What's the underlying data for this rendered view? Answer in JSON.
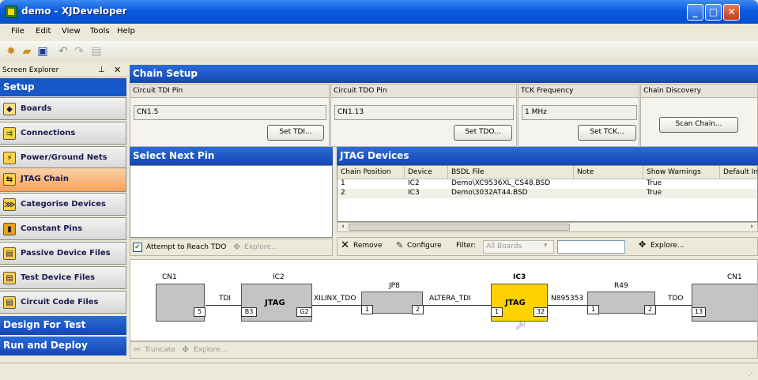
{
  "window": {
    "title": "demo - XJDeveloper",
    "min": "_",
    "max": "□",
    "close": "✕"
  },
  "menu": {
    "file": "File",
    "edit": "Edit",
    "view": "View",
    "tools": "Tools",
    "help": "Help"
  },
  "left_pane": {
    "header": "Screen Explorer",
    "setup": "Setup",
    "items": [
      {
        "label": "Boards",
        "icon": "boards-icon"
      },
      {
        "label": "Connections",
        "icon": "connections-icon"
      },
      {
        "label": "Power/Ground Nets",
        "icon": "power-icon"
      },
      {
        "label": "JTAG Chain",
        "icon": "jtag-chain-icon"
      },
      {
        "label": "Categorise Devices",
        "icon": "categorise-icon"
      },
      {
        "label": "Constant Pins",
        "icon": "lock-icon"
      },
      {
        "label": "Passive Device Files",
        "icon": "file-icon"
      },
      {
        "label": "Test Device Files",
        "icon": "file-icon"
      },
      {
        "label": "Circuit Code Files",
        "icon": "file-icon"
      }
    ],
    "design_for_test": "Design For Test",
    "run_and_deploy": "Run and Deploy"
  },
  "chain_setup": {
    "title": "Chain Setup",
    "tdi": {
      "label": "Circuit TDI Pin",
      "value": "CN1.5",
      "button": "Set TDI..."
    },
    "tdo": {
      "label": "Circuit TDO Pin",
      "value": "CN1.13",
      "button": "Set TDO..."
    },
    "tck": {
      "label": "TCK Frequency",
      "value": "1 MHz",
      "button": "Set TCK..."
    },
    "discovery": {
      "label": "Chain Discovery",
      "button": "Scan Chain..."
    }
  },
  "select_pin": {
    "title": "Select Next Pin",
    "attempt": "Attempt to Reach TDO",
    "explore": "Explore..."
  },
  "jtag_devices": {
    "title": "JTAG Devices",
    "columns": [
      "Chain Position",
      "Device",
      "BSDL File",
      "Note",
      "Show Warnings",
      "Default In"
    ],
    "rows": [
      {
        "pos": "1",
        "device": "IC2",
        "bsdl": "Demo\\XC9536XL_CS48.BSD",
        "note": "",
        "warn": "True"
      },
      {
        "pos": "2",
        "device": "IC3",
        "bsdl": "Demo\\3032AT44.BSD",
        "note": "",
        "warn": "True"
      }
    ],
    "remove": "Remove",
    "configure": "Configure",
    "filter_label": "Filter:",
    "filter_value": "All Boards",
    "explore": "Explore..."
  },
  "diagram": {
    "cn1_left": "CN1",
    "ic2": "IC2",
    "jtag": "JTAG",
    "jp8": "JP8",
    "ic3": "IC3",
    "r49": "R49",
    "cn1_right": "CN1",
    "tdi": "TDI",
    "xilinx_tdo": "XILINX_TDO",
    "altera_tdi": "ALTERA_TDI",
    "n895353": "N895353",
    "tdo": "TDO",
    "pins": [
      "5",
      "B3",
      "G2",
      "1",
      "2",
      "1",
      "32",
      "1",
      "2",
      "13"
    ],
    "truncate": "Truncate",
    "explore": "Explore..."
  },
  "colors": {
    "accent": "#1857c8",
    "highlight": "#ffd200",
    "active_nav": "#f6a15c"
  }
}
